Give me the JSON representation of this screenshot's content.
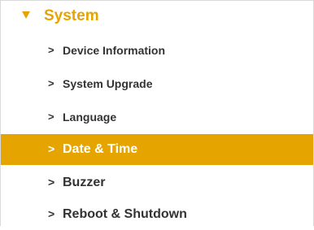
{
  "section": {
    "title": "System",
    "icon": "caret-down-icon",
    "accent_color": "#e5a400"
  },
  "items": [
    {
      "label": "Device Information",
      "chevron": ">"
    },
    {
      "label": "System Upgrade",
      "chevron": ">"
    },
    {
      "label": "Language",
      "chevron": ">"
    },
    {
      "label": "Date & Time",
      "chevron": ">",
      "active": true
    },
    {
      "label": "Buzzer",
      "chevron": ">"
    },
    {
      "label": "Reboot & Shutdown",
      "chevron": ">"
    }
  ]
}
